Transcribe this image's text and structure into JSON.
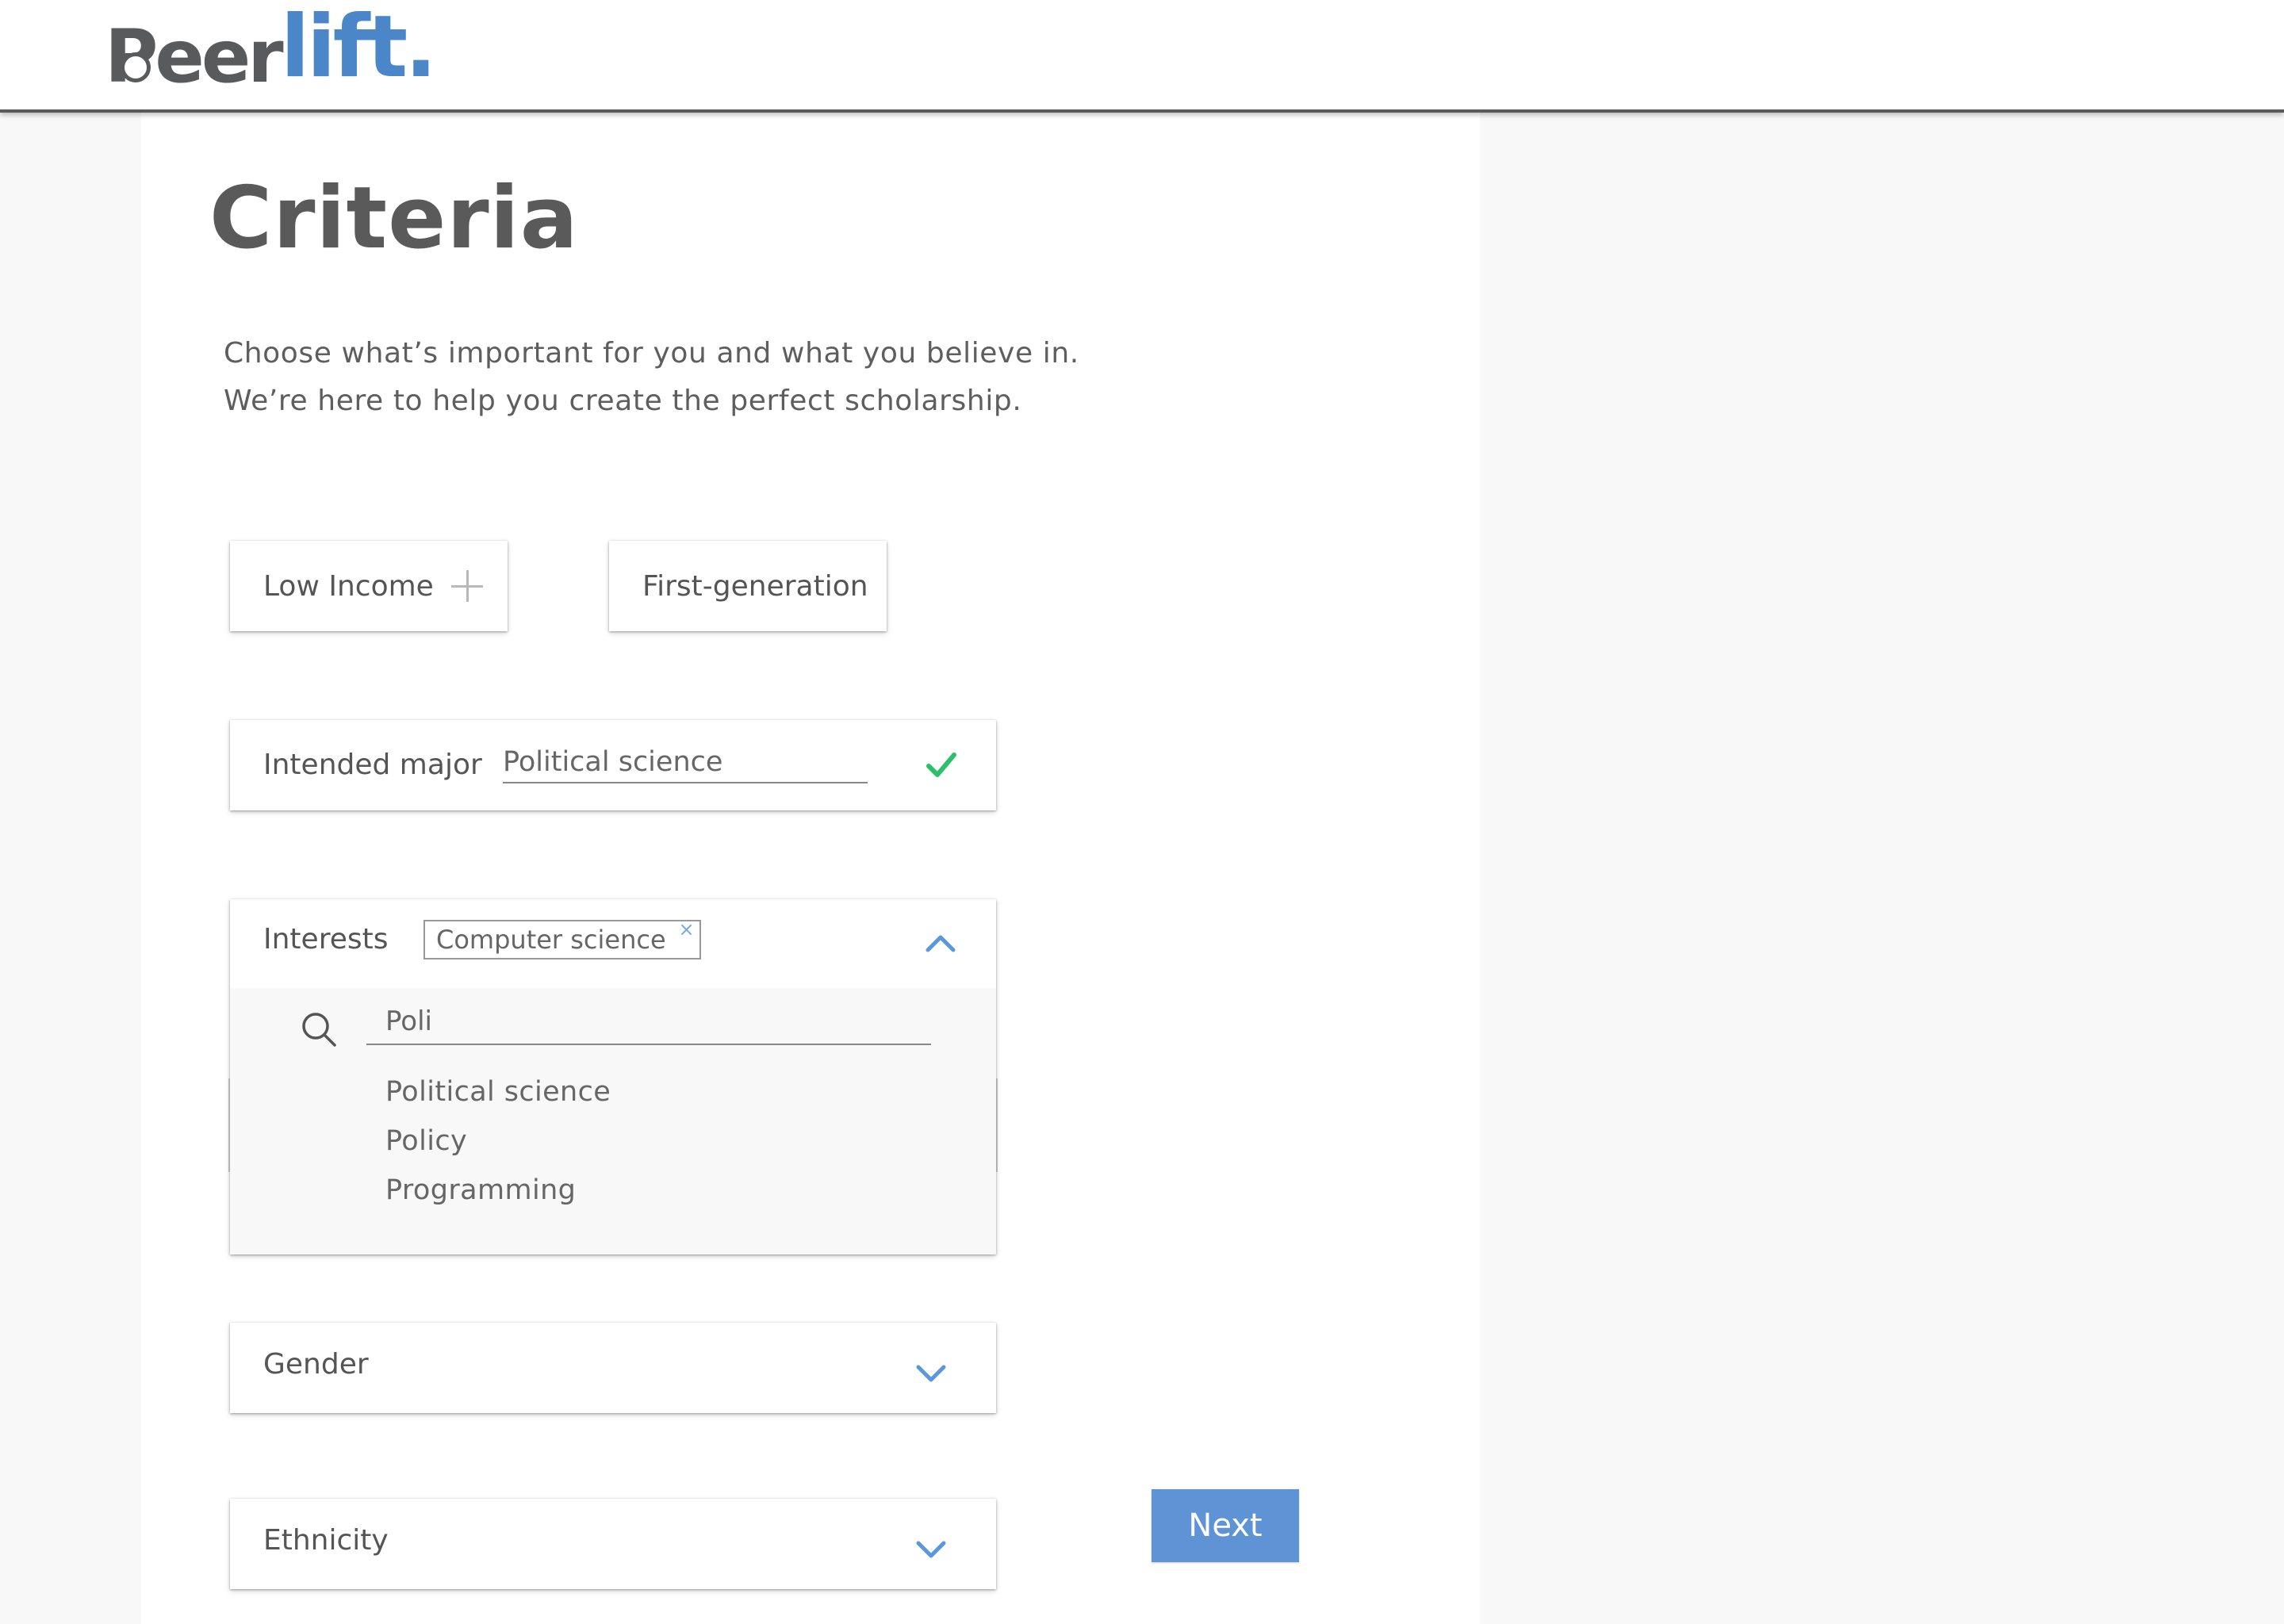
{
  "brand": {
    "logo_part1": "Peer",
    "logo_part2": "lift.",
    "color_dark": "#595a5c",
    "color_accent": "#4a86c8"
  },
  "page": {
    "title": "Criteria",
    "intro_line1": "Choose what’s important for you and what you believe in.",
    "intro_line2": "We’re here to help you create the perfect scholarship."
  },
  "toggles": {
    "low_income_label": "Low Income",
    "first_generation_label": "First-generation"
  },
  "intended_major": {
    "label": "Intended major",
    "value": "Political science",
    "status_icon": "check-icon",
    "status_color": "#2bc06a"
  },
  "interests": {
    "label": "Interests",
    "selected_chips": [
      "Computer science"
    ],
    "chip_remove_glyph": "×",
    "search_value": "Poli",
    "suggestions": [
      "Political science",
      "Policy",
      "Programming"
    ],
    "expanded": true
  },
  "gender": {
    "label": "Gender"
  },
  "ethnicity": {
    "label": "Ethnicity"
  },
  "actions": {
    "next_label": "Next",
    "next_color": "#5e93d6"
  },
  "icons": {
    "chevron_color": "#5b97dd",
    "search": "search-icon",
    "chevron_up": "chevron-up-icon",
    "chevron_down": "chevron-down-icon",
    "plus": "plus-icon"
  }
}
